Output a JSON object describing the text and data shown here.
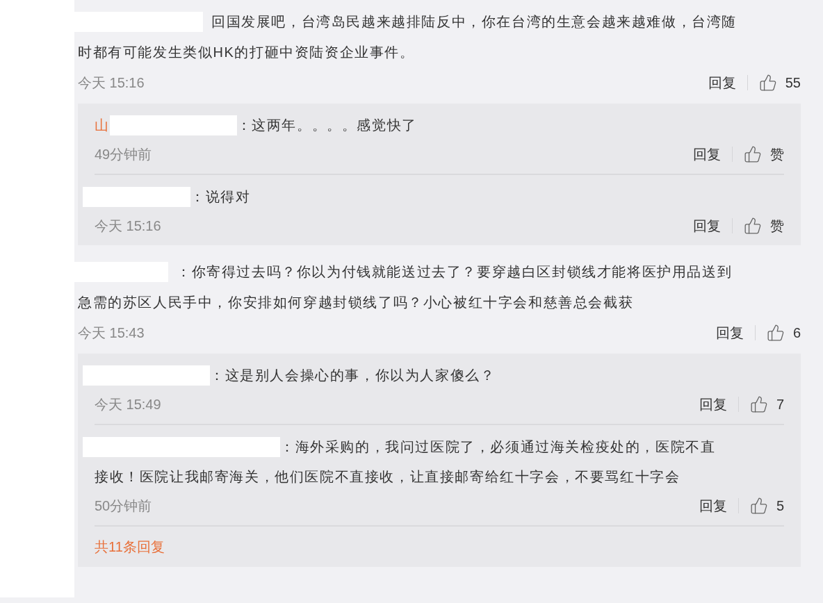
{
  "comments": [
    {
      "lines": [
        "回国发展吧，台湾岛民越来越排陆反中，你在台湾的生意会越来越难做，台湾随",
        "时都有可能发生类似HK的打砸中资陆资企业事件。"
      ],
      "time": "今天 15:16",
      "reply_label": "回复",
      "likes": "55",
      "replies": [
        {
          "name_prefix": "山",
          "lines": [
            "：这两年。。。。感觉快了"
          ],
          "time": "49分钟前",
          "reply_label": "回复",
          "likes": "赞"
        },
        {
          "lines": [
            "：说得对"
          ],
          "time": "今天 15:16",
          "reply_label": "回复",
          "likes": "赞"
        }
      ]
    },
    {
      "lines": [
        "：你寄得过去吗？你以为付钱就能送过去了？要穿越白区封锁线才能将医护用品送到",
        "急需的苏区人民手中，你安排如何穿越封锁线了吗？小心被红十字会和慈善总会截获"
      ],
      "time": "今天 15:43",
      "reply_label": "回复",
      "likes": "6",
      "replies": [
        {
          "lines": [
            "：这是别人会操心的事，你以为人家傻么？"
          ],
          "time": "今天 15:49",
          "reply_label": "回复",
          "likes": "7"
        },
        {
          "lines": [
            "：海外采购的，我问过医院了，必须通过海关检疫处的，医院不直",
            "接收！医院让我邮寄海关，他们医院不直接收，让直接邮寄给红十字会，不要骂红十字会"
          ],
          "time": "50分钟前",
          "reply_label": "回复",
          "likes": "5"
        }
      ],
      "more_replies": "共11条回复"
    }
  ]
}
